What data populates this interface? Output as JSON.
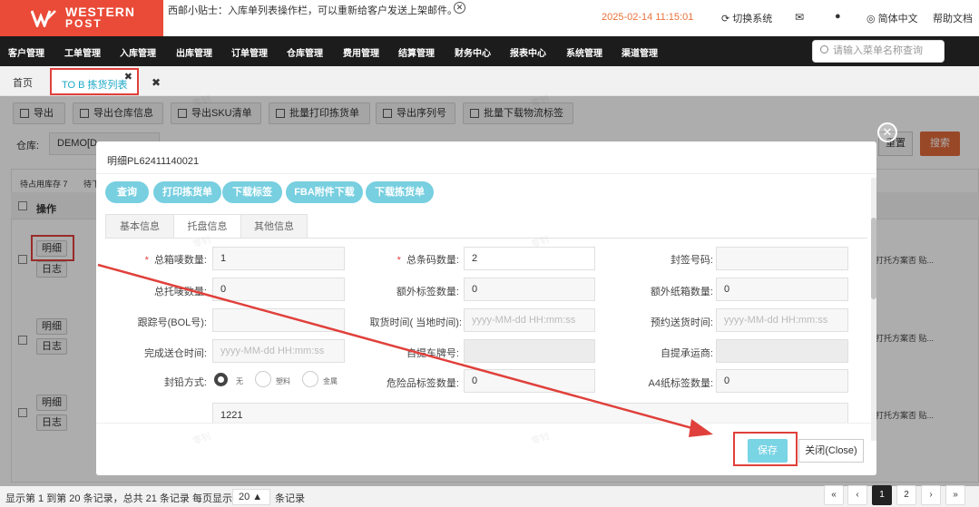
{
  "header": {
    "logo_line1": "WESTERN",
    "logo_line2": "POST",
    "tip": "西邮小贴士：入库单列表操作栏，可以重新给客户发送上架邮件。",
    "tip_close": "✕",
    "datetime": "2025-02-14 11:15:01",
    "switch_system": "切换系统",
    "language": "简体中文",
    "help": "帮助文档"
  },
  "nav": {
    "items": [
      "客户管理",
      "工单管理",
      "入库管理",
      "出库管理",
      "订单管理",
      "仓库管理",
      "费用管理",
      "结算管理",
      "财务中心",
      "报表中心",
      "系统管理",
      "渠道管理"
    ],
    "search_placeholder": "请输入菜单名称查询"
  },
  "tabs": {
    "home": "首页",
    "active": "TO B 拣货列表",
    "active_close": "✖",
    "close_all": "✖"
  },
  "toolbar": {
    "buttons": [
      "导出",
      "导出仓库信息",
      "导出SKU清单",
      "批量打印拣货单",
      "导出序列号",
      "批量下载物流标签"
    ]
  },
  "filter": {
    "warehouse_label": "仓库:",
    "warehouse_value": "DEMO[D",
    "reset": "重置",
    "search": "搜索"
  },
  "table": {
    "status_tabs": [
      "待占用库存 7",
      "待下"
    ],
    "action_header": "操作",
    "rows": [
      {
        "detail": "明细",
        "log": "日志",
        "extra": "打托方案否 贴..."
      },
      {
        "detail": "明细",
        "log": "日志",
        "extra": "打托方案否 贴..."
      },
      {
        "detail": "明细",
        "log": "日志",
        "extra": "打托方案否 贴..."
      }
    ]
  },
  "modal": {
    "title": "明细PL62411140021",
    "actions": [
      "查询",
      "打印拣货单",
      "下载标签",
      "FBA附件下载",
      "下载拣货单"
    ],
    "tabs": [
      "基本信息",
      "托盘信息",
      "其他信息"
    ],
    "fields": {
      "total_boxes_label": "总箱唛数量:",
      "total_boxes_value": "1",
      "total_codes_label": "总条码数量:",
      "total_codes_value": "2",
      "seal_no_label": "封签号码:",
      "pallet_total_label": "总托唛数量:",
      "pallet_total_value": "0",
      "extra_label_label": "额外标签数量:",
      "extra_label_value": "0",
      "extra_box_label": "额外纸箱数量:",
      "extra_box_value": "0",
      "bol_label": "跟踪号(BOL号):",
      "pickup_time_label": "取货时间( 当地时间):",
      "pickup_time_placeholder": "yyyy-MM-dd HH:mm:ss",
      "appt_time_label": "预约送货时间:",
      "appt_time_placeholder": "yyyy-MM-dd HH:mm:ss",
      "done_time_label": "完成送仓时间:",
      "done_time_placeholder": "yyyy-MM-dd HH:mm:ss",
      "plate_label": "自提车牌号:",
      "carrier_label": "自提承运商:",
      "seal_method_label": "封铅方式:",
      "seal_options": [
        "无",
        "塑料",
        "金属"
      ],
      "hazmat_label": "危险品标签数量:",
      "hazmat_value": "0",
      "a4_label": "A4纸标签数量:",
      "a4_value": "0",
      "remark_value": "1221"
    },
    "save": "保存",
    "close": "关闭(Close)",
    "close_icon": "✕"
  },
  "pager": {
    "info": "显示第 1 到第 20 条记录，总共 21 条记录 每页显示",
    "page_size": "20 ▲",
    "unit": "条记录",
    "pages": [
      "«",
      "‹",
      "1",
      "2",
      "›",
      "»"
    ],
    "current": "1"
  },
  "watermark": "零钊"
}
